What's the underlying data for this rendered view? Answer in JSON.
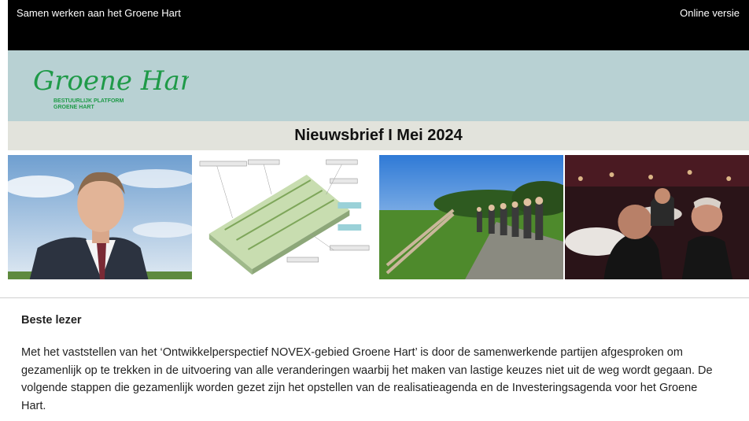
{
  "topbar": {
    "tagline": "Samen werken aan het Groene Hart",
    "online_version": "Online versie"
  },
  "logo": {
    "name": "Groene Hart",
    "sub1": "BESTUURLIJK PLATFORM",
    "sub2": "GROENE HART"
  },
  "newsletter_title": "Nieuwsbrief I Mei 2024",
  "photos": [
    {
      "icon": "portrait-photo"
    },
    {
      "icon": "landscape-diagram"
    },
    {
      "icon": "outdoor-gathering-photo"
    },
    {
      "icon": "dinner-event-photo"
    }
  ],
  "body": {
    "greeting": "Beste lezer",
    "paragraph": "Met het vaststellen van het ‘Ontwikkelperspectief NOVEX-gebied Groene Hart’ is door de samenwerkende partijen afgesproken om gezamenlijk op te trekken in de uitvoering van alle veranderingen waarbij het maken van lastige keuzes niet uit de weg wordt gegaan. De volgende stappen die gezamenlijk worden gezet zijn het opstellen van de realisatieagenda en de Investeringsagenda voor het Groene Hart."
  },
  "colors": {
    "brand_green": "#1f9a48",
    "topbar": "#000000",
    "logo_band": "#b8d1d3",
    "title_band": "#e2e3dc"
  }
}
